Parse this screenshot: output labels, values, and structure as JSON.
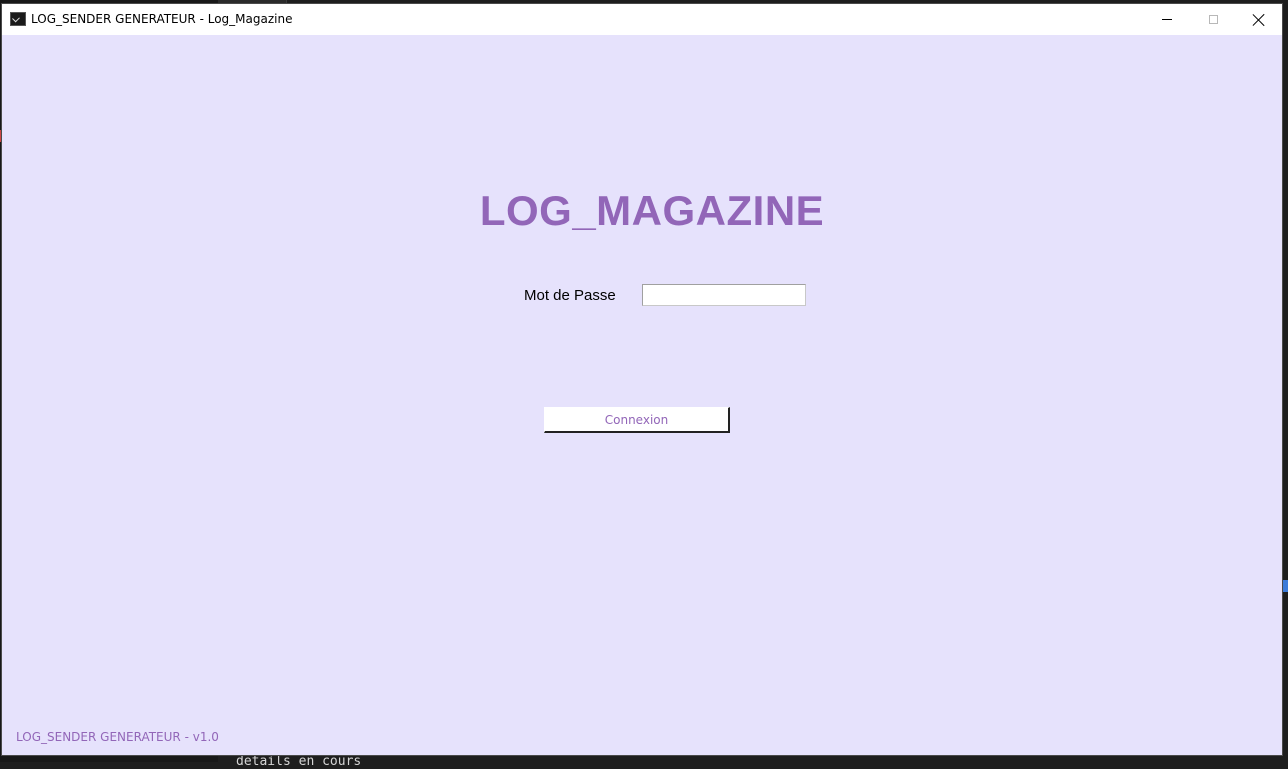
{
  "window": {
    "title": "LOG_SENDER GENERATEUR - Log_Magazine",
    "icon": "console-icon"
  },
  "titlebar_buttons": {
    "minimize": "minimize-icon",
    "maximize": "maximize-icon",
    "close": "close-icon"
  },
  "login": {
    "heading": "LOG_MAGAZINE",
    "password_label": "Mot de Passe",
    "password_value": "",
    "submit_label": "Connexion"
  },
  "footer": {
    "version_text": "LOG_SENDER GENERATEUR - v1.0"
  },
  "background": {
    "code_snippet": "details en cours"
  },
  "colors": {
    "accent": "#9266b8",
    "window_background": "#e6e2fc",
    "titlebar": "#ffffff"
  }
}
